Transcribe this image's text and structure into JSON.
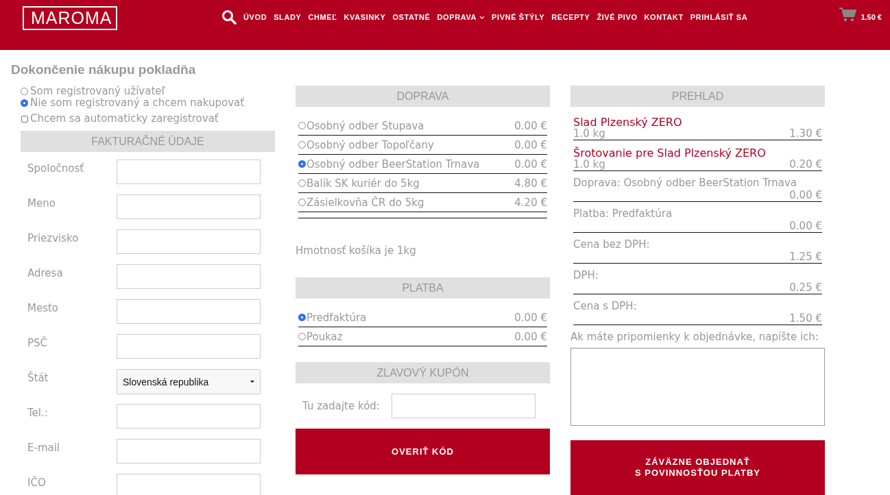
{
  "header": {
    "logo": "MAROMA",
    "nav": [
      {
        "label": "ÚVOD",
        "dropdown": false
      },
      {
        "label": "SLADY",
        "dropdown": false
      },
      {
        "label": "CHMEĽ",
        "dropdown": false
      },
      {
        "label": "KVASINKY",
        "dropdown": false
      },
      {
        "label": "OSTATNÉ",
        "dropdown": false
      },
      {
        "label": "DOPRAVA",
        "dropdown": true
      },
      {
        "label": "PIVNÉ ŠTÝLY",
        "dropdown": false
      },
      {
        "label": "RECEPTY",
        "dropdown": false
      },
      {
        "label": "ŽIVÉ PIVO",
        "dropdown": false
      },
      {
        "label": "KONTAKT",
        "dropdown": false
      },
      {
        "label": "PRIHLÁSIŤ SA",
        "dropdown": false
      }
    ],
    "cart_total": "1.50 €"
  },
  "page_title": "Dokončenie nákupu pokladňa",
  "customer_type": [
    {
      "label": "Som registrovaný užívateľ",
      "selected": false
    },
    {
      "label": "Nie som registrovaný a chcem nakupovať",
      "selected": true
    }
  ],
  "auto_register": {
    "label": "Chcem sa automaticky zaregistrovať",
    "checked": false
  },
  "billing": {
    "title": "FAKTURAČNÉ ÚDAJE",
    "fields": [
      {
        "label": "Spoločnosť",
        "kind": "text"
      },
      {
        "label": "Meno",
        "kind": "text"
      },
      {
        "label": "Priezvisko",
        "kind": "text"
      },
      {
        "label": "Adresa",
        "kind": "text"
      },
      {
        "label": "Mesto",
        "kind": "text"
      },
      {
        "label": "PSČ",
        "kind": "text"
      },
      {
        "label": "Štát",
        "kind": "select",
        "value": "Slovenská republika"
      },
      {
        "label": "Tel.:",
        "kind": "text"
      },
      {
        "label": "E-mail",
        "kind": "text"
      },
      {
        "label": "IČO",
        "kind": "text"
      }
    ]
  },
  "shipping": {
    "title": "DOPRAVA",
    "options": [
      {
        "label": "Osobný odber Stupava",
        "price": "0.00 €",
        "selected": false
      },
      {
        "label": "Osobný odber Topoľčany",
        "price": "0.00 €",
        "selected": false
      },
      {
        "label": "Osobný odber BeerStation Trnava",
        "price": "0.00 €",
        "selected": true
      },
      {
        "label": "Balík SK kuriér do 5kg",
        "price": "4.80 €",
        "selected": false
      },
      {
        "label": "Zásielkovňa ČR do 5kg",
        "price": "4.20 €",
        "selected": false
      }
    ],
    "weight_note": "Hmotnosť košíka je 1kg"
  },
  "payment": {
    "title": "PLATBA",
    "options": [
      {
        "label": "Predfaktúra",
        "price": "0.00 €",
        "selected": true
      },
      {
        "label": "Poukaz",
        "price": "0.00 €",
        "selected": false
      }
    ]
  },
  "coupon": {
    "title": "ZLAVOVÝ KUPÓN",
    "label": "Tu zadajte kód:",
    "button": "OVERIŤ KÓD"
  },
  "summary": {
    "title": "PREHLAD",
    "items": [
      {
        "kind": "product",
        "name": "Slad Plzenský ZERO",
        "qty": "1.0 kg",
        "price": "1.30 €"
      },
      {
        "kind": "product",
        "name": "Šrotovanie pre Slad Plzenský ZERO",
        "qty": "1.0 kg",
        "price": "0.20 €"
      },
      {
        "kind": "line",
        "name": "Doprava: Osobný odber BeerStation Trnava",
        "price": "0.00 €"
      },
      {
        "kind": "line",
        "name": "Platba: Predfaktúra",
        "price": "0.00 €"
      },
      {
        "kind": "line",
        "name": "Cena bez DPH:",
        "price": "1.25 €"
      },
      {
        "kind": "line",
        "name": "DPH:",
        "price": "0.25 €"
      },
      {
        "kind": "line",
        "name": "Cena s DPH:",
        "price": "1.50 €"
      }
    ],
    "note_label": "Ak máte pripomienky k objednávke, napíšte ich:",
    "order_button": [
      "ZÁVÄZNE OBJEDNAŤ",
      "S POVINNOSŤOU PLATBY"
    ]
  }
}
